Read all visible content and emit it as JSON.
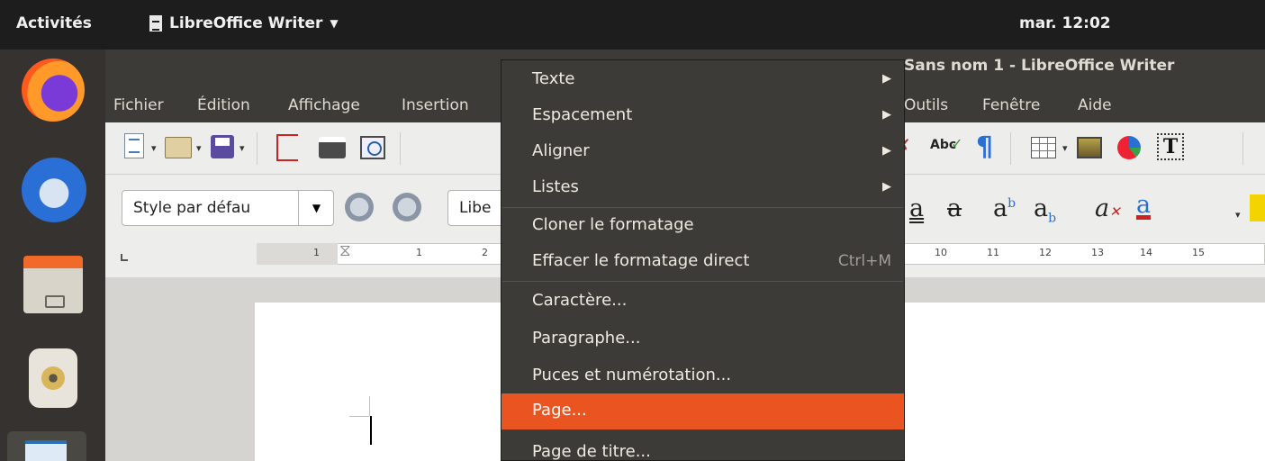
{
  "topbar": {
    "activities": "Activités",
    "app_name": "LibreOffice Writer",
    "clock": "mar. 12:02"
  },
  "window": {
    "title": "Sans nom 1 - LibreOffice Writer"
  },
  "menubar": {
    "items": [
      "Fichier",
      "Édition",
      "Affichage",
      "Insertion",
      "Outils",
      "Fenêtre",
      "Aide"
    ]
  },
  "formatting_toolbar": {
    "paragraph_style": "Style par défau",
    "font_name": "Libe"
  },
  "ruler": {
    "ticks": [
      "1",
      "1",
      "2",
      "10",
      "11",
      "12",
      "13",
      "14",
      "15"
    ]
  },
  "context_menu": {
    "items": [
      {
        "label": "Texte",
        "submenu": true
      },
      {
        "label": "Espacement",
        "submenu": true
      },
      {
        "label": "Aligner",
        "submenu": true
      },
      {
        "label": "Listes",
        "submenu": true
      },
      {
        "label": "Cloner le formatage"
      },
      {
        "label": "Effacer le formatage direct",
        "shortcut": "Ctrl+M"
      },
      {
        "label": "Caractère..."
      },
      {
        "label": "Paragraphe..."
      },
      {
        "label": "Puces et numérotation..."
      },
      {
        "label": "Page...",
        "highlighted": true
      },
      {
        "label": "Page de titre..."
      }
    ]
  },
  "dock": {
    "icons": [
      "firefox-icon",
      "thunderbird-icon",
      "files-icon",
      "rhythmbox-icon",
      "writer-icon"
    ]
  },
  "colors": {
    "highlight": "#e95420",
    "menu_bg": "#3d3b37",
    "topbar_bg": "#1d1d1d"
  }
}
